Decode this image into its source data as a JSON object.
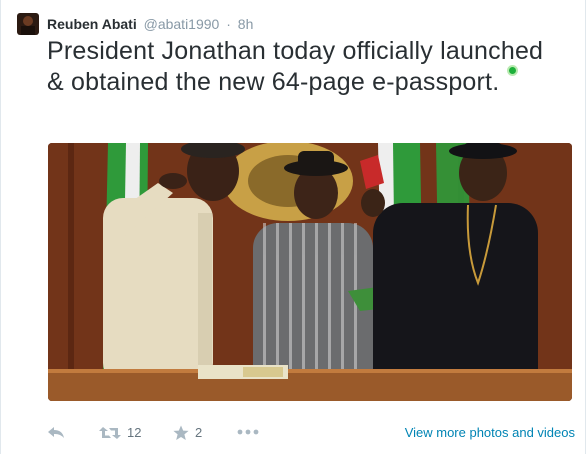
{
  "author": {
    "name": "Reuben Abati",
    "handle": "@abati1990",
    "separator": "·",
    "time": "8h"
  },
  "tweet": {
    "text": "President Jonathan today officially launched & obtained the new 64-page e-passport."
  },
  "actions": {
    "retweet_count": "12",
    "favorite_count": "2",
    "view_more_label": "View more photos and videos"
  },
  "icons": {
    "reply": "reply-icon",
    "retweet": "retweet-icon",
    "favorite": "star-icon",
    "more": "more-dots-icon"
  },
  "colors": {
    "link": "#0084b4",
    "muted": "#8899a6",
    "text": "#292f33"
  }
}
